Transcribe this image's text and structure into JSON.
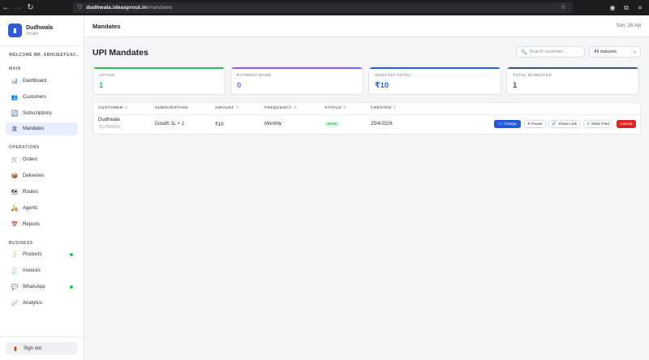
{
  "browser": {
    "url_host": "dudhwala.ideasprout.in",
    "url_path": "/mandates"
  },
  "sidebar": {
    "brand_name": "Dudhwala",
    "brand_sub": "Vendor",
    "welcome": "WELCOME MR. ABHIJEETGAV...",
    "sections": {
      "main": "MAIN",
      "operations": "OPERATIONS",
      "business": "BUSINESS"
    },
    "items": [
      {
        "label": "Dashboard",
        "icon": "chart-icon"
      },
      {
        "label": "Customers",
        "icon": "users-icon"
      },
      {
        "label": "Subscriptions",
        "icon": "refresh-icon"
      },
      {
        "label": "Mandates",
        "icon": "bank-icon"
      },
      {
        "label": "Orders",
        "icon": "cart-icon"
      },
      {
        "label": "Deliveries",
        "icon": "package-icon"
      },
      {
        "label": "Routes",
        "icon": "map-icon"
      },
      {
        "label": "Agents",
        "icon": "scooter-icon"
      },
      {
        "label": "Reports",
        "icon": "calendar-icon"
      },
      {
        "label": "Products",
        "icon": "cup-icon"
      },
      {
        "label": "Invoices",
        "icon": "receipt-icon"
      },
      {
        "label": "WhatsApp",
        "icon": "chat-icon"
      },
      {
        "label": "Analytics",
        "icon": "trend-icon"
      }
    ],
    "signout": "Sign out"
  },
  "topbar": {
    "title": "Mandates",
    "date": "Sun, 26 Apr"
  },
  "page": {
    "title": "UPI Mandates",
    "search_placeholder": "Search customer...",
    "status_filter": "All statuses"
  },
  "cards": [
    {
      "label": "ACTIVE",
      "value": "1",
      "color": "#22c55e"
    },
    {
      "label": "PAYMENT MADE",
      "value": "0",
      "color": "#8b5cf6"
    },
    {
      "label": "MONTHLY TOTAL",
      "value": "₹10",
      "color": "#2563eb"
    },
    {
      "label": "TOTAL MANDATES",
      "value": "1",
      "color": "#475569"
    }
  ],
  "table": {
    "headers": [
      "CUSTOMER",
      "SUBSCRIPTION",
      "AMOUNT",
      "FREQUENCY",
      "STATUS",
      "CREATED"
    ],
    "sort_glyph": "⇅",
    "row": {
      "customer": "Dudhwala",
      "phone": "7517890047",
      "subscription": "Doodh 1L × 1",
      "amount": "₹10",
      "frequency": "Monthly",
      "status": "active",
      "created": "25/4/2026"
    },
    "actions": {
      "charge": "Charge",
      "pause": "Pause",
      "share": "Share Link",
      "mark_paid": "Mark Paid",
      "cancel": "Cancel"
    }
  }
}
